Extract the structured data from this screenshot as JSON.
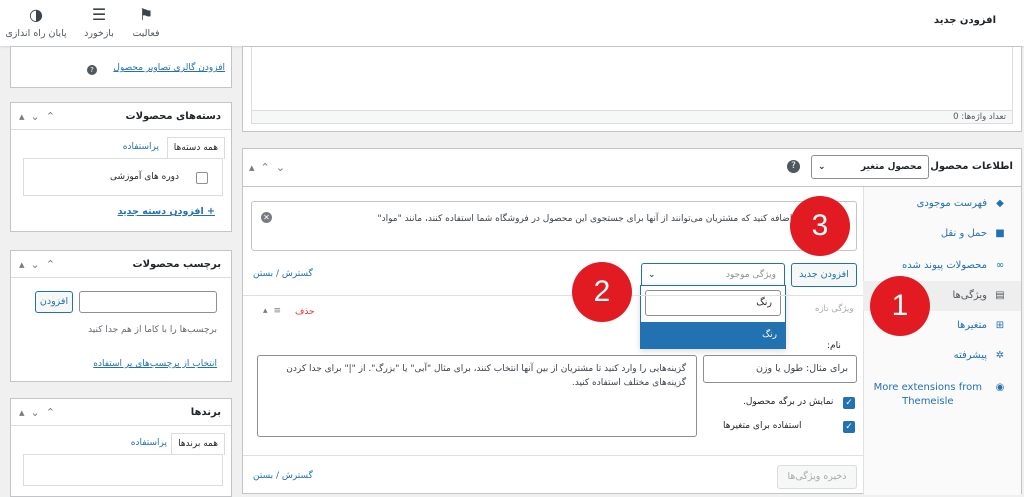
{
  "header": {
    "title": "افزودن جدید",
    "items": [
      {
        "label": "فعالیت",
        "icon": "flag-icon"
      },
      {
        "label": "بازخورد",
        "icon": "feedback-icon"
      },
      {
        "label": "پایان راه اندازی",
        "icon": "finish-setup-icon"
      }
    ]
  },
  "editor": {
    "word_count": "تعداد واژه‌ها: 0"
  },
  "product_data": {
    "title": "اطلاعات محصول —",
    "type_value": "محصول متغیر",
    "tabs": [
      {
        "label": "فهرست موجودی",
        "icon": "inventory-icon"
      },
      {
        "label": "حمل و نقل",
        "icon": "shipping-icon"
      },
      {
        "label": "محصولات پیوند شده",
        "icon": "link-icon"
      },
      {
        "label": "ویژگی‌ها",
        "icon": "attributes-icon"
      },
      {
        "label": "متغیرها",
        "icon": "variations-icon"
      },
      {
        "label": "پیشرفته",
        "icon": "gear-icon"
      },
      {
        "label": "More extensions from Themeisle",
        "icon": "plugin-icon"
      }
    ],
    "notice": "ویژگی‌هایی را اضافه کنید که مشتریان می‌توانند از آنها برای جستجوی این محصول در فروشگاه شما استفاده کنند، مانند \"مواد\"",
    "expand_collapse": "گسترش / بستن",
    "add_new_button": "افزودن جدید",
    "existing_attr_placeholder": "ویژگی موجود",
    "dropdown_search_value": "رنگ",
    "dropdown_option": "رنگ",
    "new_attr_label": "ویژگی تازه",
    "delete_label": "حذف",
    "name_label": "نام:",
    "name_placeholder": "برای مثال: طول یا وزن",
    "values_placeholder": "گزینه‌هایی را وارد کنید تا مشتریان از بین آنها انتخاب کنند، برای مثال \"آبی\" یا \"بزرگ\". از \"|\" برای جدا کردن گزینه‌های مختلف استفاده کنید.",
    "visible_label": "نمایش در برگه محصول.",
    "variation_label": "استفاده برای متغیرها",
    "save_button": "ذخیره ویژگی‌ها"
  },
  "sidebar": {
    "gallery_link": "افزودن گالری تصاویر محصول",
    "categories": {
      "title": "دسته‌های محصولات",
      "tab_all": "همه دسته‌ها",
      "tab_popular": "پراستفاده",
      "items": [
        "دوره های آموزشی"
      ],
      "add_link": "+ افزودن دسته جدید"
    },
    "tags": {
      "title": "برچسب محصولات",
      "add_button": "افزودن",
      "hint": "برچسب‌ها را با کاما از هم جدا کنید",
      "choose_link": "انتخاب از برچسب‌های پر استفاده"
    },
    "brands": {
      "title": "برندها",
      "tab_all": "همه برندها",
      "tab_popular": "پراستفاده"
    }
  },
  "annotations": [
    "1",
    "2",
    "3"
  ],
  "colors": {
    "accent": "#2271b1",
    "marker": "#e21b23",
    "danger": "#d63638"
  }
}
